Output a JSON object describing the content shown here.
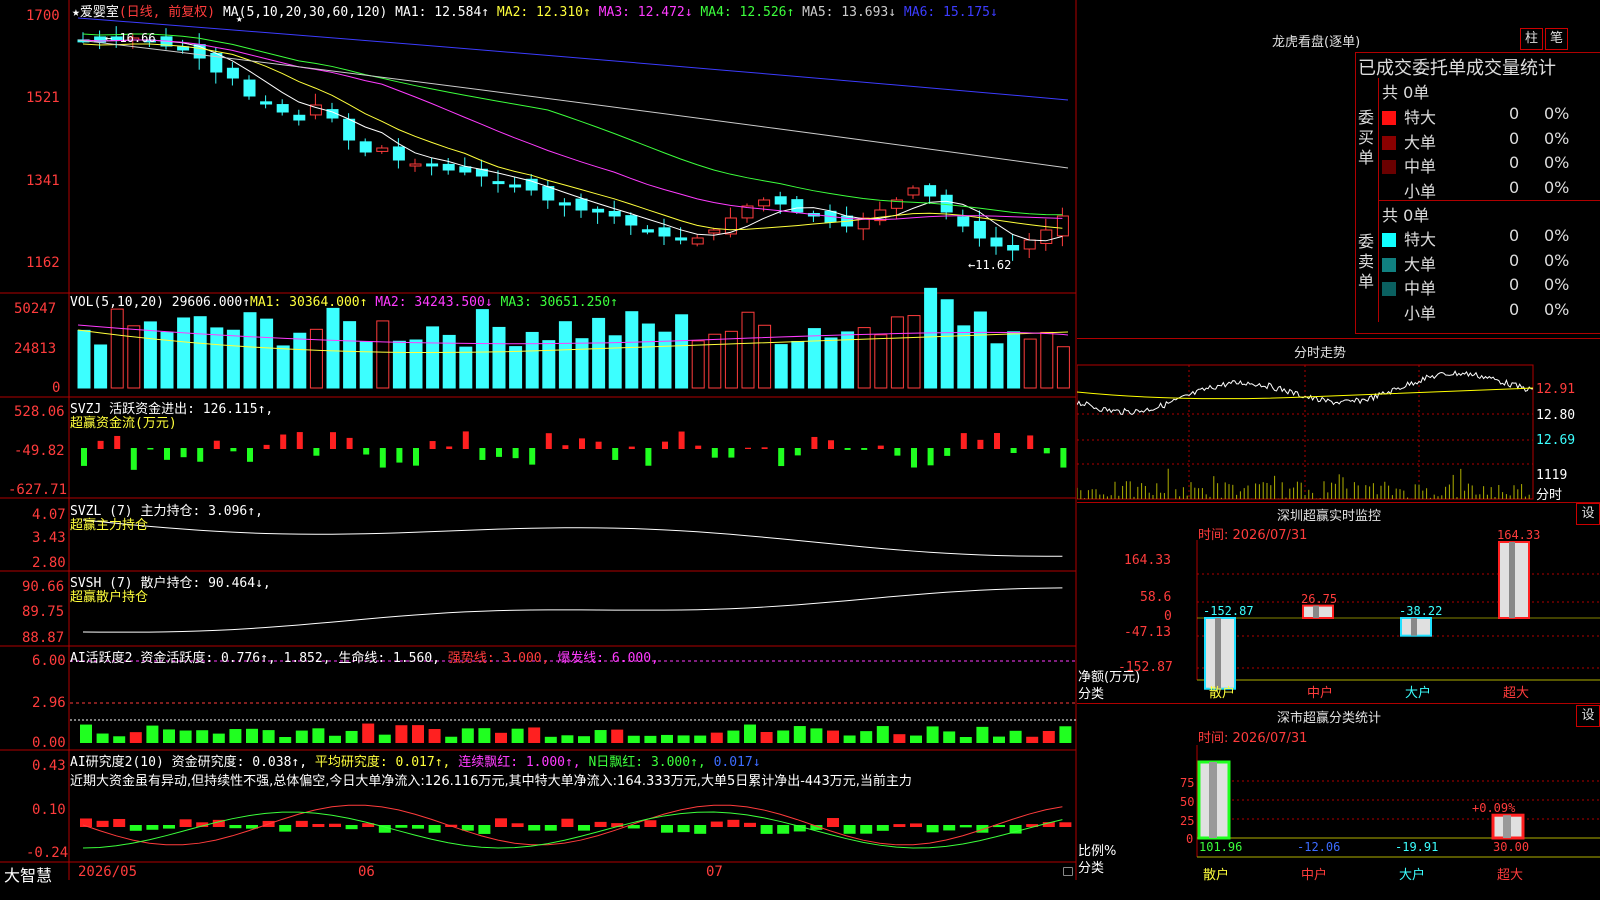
{
  "stock": {
    "title": "★爱婴室",
    "period": "(日线, 前复权)",
    "ma_label": "MA(5,10,20,30,60,120)",
    "star": "★"
  },
  "ma_values": [
    {
      "label": "MA1: 12.584↑",
      "color": "#ffffff"
    },
    {
      "label": "MA2: 12.310↑",
      "color": "#ffff3c"
    },
    {
      "label": "MA3: 12.472↓",
      "color": "#ff3cff"
    },
    {
      "label": "MA4: 12.526↑",
      "color": "#3cff3c"
    },
    {
      "label": "MA5: 13.693↓",
      "color": "#cccccc"
    },
    {
      "label": "MA6: 15.175↓",
      "color": "#3c3cff"
    }
  ],
  "price_axis": [
    "1700",
    "1521",
    "1341",
    "1162"
  ],
  "price_marks": {
    "high": "← 16.66",
    "low": "←11.62"
  },
  "vol": {
    "title": "VOL(5,10,20)",
    "value": "29606.000↑",
    "ma1": "MA1: 30364.000↑",
    "ma2": "MA2: 34243.500↓",
    "ma3": "MA3: 30651.250↑",
    "axis": [
      "50247",
      "24813",
      "0"
    ]
  },
  "svzj": {
    "title": "SVZJ",
    "label": "活跃资金进出: 126.115↑,",
    "sub": "超赢资金流(万元)",
    "axis": [
      "528.06",
      "-49.82",
      "-627.71"
    ]
  },
  "svzl": {
    "title": "SVZL (7)",
    "label": "主力持仓: 3.096↑,",
    "sub": "超赢主力持仓",
    "axis": [
      "4.07",
      "3.43",
      "2.80"
    ]
  },
  "svsh": {
    "title": "SVSH (7)",
    "label": "散户持仓: 90.464↓,",
    "sub": "超赢散户持仓",
    "axis": [
      "90.66",
      "89.75",
      "88.87"
    ]
  },
  "ai2": {
    "title": "AI活跃度2",
    "label1": "资金活跃度: 0.776↑, 1.852, 生命线: 1.560,",
    "strong": "强势线: 3.000,",
    "burst": "爆发线: 6.000,",
    "axis": [
      "6.00",
      "2.96",
      "0.00"
    ]
  },
  "ai_research": {
    "title": "AI研究度2(10)",
    "label1": "资金研究度: 0.038↑,",
    "avg": "平均研究度: 0.017↑,",
    "cont": "连续飘红: 1.000↑,",
    "nday": "N日飘红: 3.000↑,",
    "last": "0.017↓",
    "axis": [
      "0.43",
      "0.10",
      "-0.24"
    ],
    "comment": "近期大资金虽有异动,但持续性不强,总体偏空,今日大单净流入:126.116万元,其中特大单净流入:164.333万元,大单5日累计净出-443万元,当前主力"
  },
  "bottom": {
    "brand": "大智慧",
    "dates": [
      "2026/05",
      "06",
      "07"
    ]
  },
  "right": {
    "dragon_title": "龙虎看盘(逐单)",
    "btn_bar": "柱",
    "btn_line": "笔",
    "stat_title": "已成交委托单成交量统计",
    "buy": {
      "group": "委买单",
      "total": "共 0单",
      "rows": [
        {
          "label": "特大",
          "val": "0",
          "pct": "0%",
          "color": "#ff1010"
        },
        {
          "label": "大单",
          "val": "0",
          "pct": "0%",
          "color": "#8a0000"
        },
        {
          "label": "中单",
          "val": "0",
          "pct": "0%",
          "color": "#6a0000"
        },
        {
          "label": "小单",
          "val": "0",
          "pct": "0%",
          "color": "#000000"
        }
      ]
    },
    "sell": {
      "group": "委卖单",
      "total": "共 0单",
      "rows": [
        {
          "label": "特大",
          "val": "0",
          "pct": "0%",
          "color": "#10ffff"
        },
        {
          "label": "大单",
          "val": "0",
          "pct": "0%",
          "color": "#108080"
        },
        {
          "label": "中单",
          "val": "0",
          "pct": "0%",
          "color": "#0a6060"
        },
        {
          "label": "小单",
          "val": "0",
          "pct": "0%",
          "color": "#000000"
        }
      ]
    },
    "intraday": {
      "title": "分时走势",
      "axis": [
        "12.91",
        "12.80",
        "12.69"
      ],
      "vol_label": "1119",
      "vol_unit": "分时"
    },
    "monitor": {
      "title": "深圳超赢实时监控",
      "btn": "设",
      "time": "时间: 2026/07/31",
      "axis": [
        "164.33",
        "58.6",
        "0",
        "-47.13",
        "-152.87"
      ],
      "bars": [
        {
          "label": "散户",
          "value": "-152.87"
        },
        {
          "label": "中户",
          "value": "26.75"
        },
        {
          "label": "大户",
          "value": "-38.22"
        },
        {
          "label": "超大",
          "value": "164.33"
        }
      ],
      "ylabel1": "净额(万元)",
      "ylabel2": "分类"
    },
    "classify": {
      "title": "深市超赢分类统计",
      "btn": "设",
      "time": "时间: 2026/07/31",
      "axis": [
        "75",
        "50",
        "25",
        "0"
      ],
      "bars": [
        {
          "label": "散户",
          "value": "101.96"
        },
        {
          "label": "中户",
          "value": "-12.06"
        },
        {
          "label": "大户",
          "value": "-19.91"
        },
        {
          "label": "超大",
          "value": "30.00"
        }
      ],
      "pct_label": "+0.09%",
      "ylabel1": "比例%",
      "ylabel2": "分类"
    }
  }
}
